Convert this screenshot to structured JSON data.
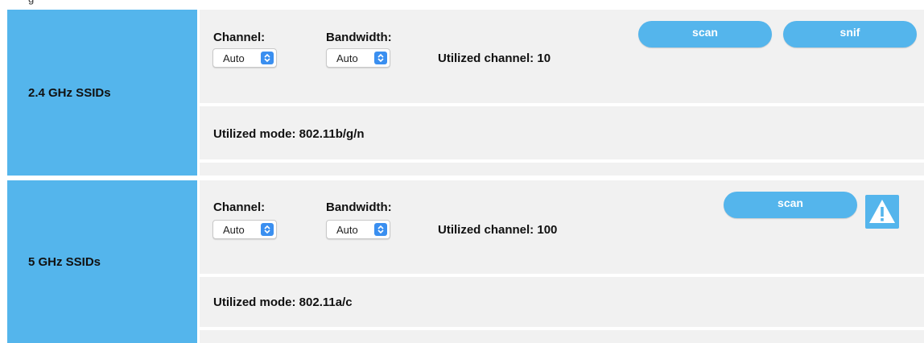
{
  "band_24": {
    "title": "2.4 GHz SSIDs",
    "channel_label": "Channel:",
    "channel_value": "Auto",
    "bandwidth_label": "Bandwidth:",
    "bandwidth_value": "Auto",
    "utilized_channel": "Utilized channel: 10",
    "scan_label": "scan",
    "snif_label": "snif",
    "utilized_mode": "Utilized mode: 802.11b/g/n"
  },
  "band_5": {
    "title": "5 GHz SSIDs",
    "channel_label": "Channel:",
    "channel_value": "Auto",
    "bandwidth_label": "Bandwidth:",
    "bandwidth_value": "Auto",
    "utilized_channel": "Utilized channel: 100",
    "scan_label": "scan",
    "warning_icon": "warning-triangle-icon",
    "utilized_mode": "Utilized mode: 802.11a/c"
  },
  "colors": {
    "accent": "#54b5ec",
    "panel_bg": "#f1f1f1",
    "select_arrow": "#3a8ff0"
  }
}
